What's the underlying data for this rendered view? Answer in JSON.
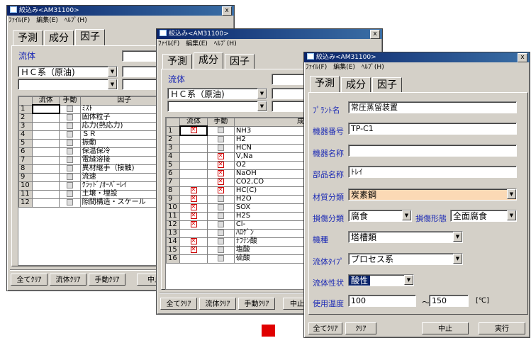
{
  "windows": {
    "title": "絞込み<AM31100>",
    "close_label": "x",
    "menu": [
      "ﾌｧｲﾙ(F)",
      "編集(E)",
      "ﾍﾙﾌﾟ(H)"
    ],
    "tabs": [
      "予測",
      "成分",
      "因子"
    ]
  },
  "win1": {
    "fluid_label": "流体",
    "fluid_value": "ＨＣ系（原油)",
    "grid_headers": [
      "流体",
      "手動",
      "因子"
    ],
    "rows": [
      "ﾐｽﾄ",
      "固体粒子",
      "応力(熱応力)",
      "ＳＲ",
      "振動",
      "保温保冷",
      "電縫溶接",
      "異材継手（接触)",
      "流速",
      "ｸﾗｯﾄﾞ/ｵｰﾊﾞｰﾚｲ",
      "土壌・埋設",
      "隙間構造・スケール"
    ],
    "row_numbers": [
      "1",
      "2",
      "3",
      "4",
      "5",
      "6",
      "7",
      "8",
      "9",
      "10",
      "11",
      "12"
    ],
    "buttons": [
      "全てｸﾘｱ",
      "流体ｸﾘｱ",
      "手動ｸﾘｱ",
      "中止"
    ]
  },
  "win2": {
    "fluid_label": "流体",
    "fluid_value": "ＨＣ系（原油)",
    "grid_headers": [
      "流体",
      "手動",
      "成分"
    ],
    "rows": [
      {
        "n": "1",
        "fluid": true,
        "manual": false,
        "name": "NH3"
      },
      {
        "n": "2",
        "fluid": false,
        "manual": false,
        "name": "H2"
      },
      {
        "n": "3",
        "fluid": false,
        "manual": false,
        "name": "HCN"
      },
      {
        "n": "4",
        "fluid": false,
        "manual": true,
        "name": "V,Na"
      },
      {
        "n": "5",
        "fluid": false,
        "manual": true,
        "name": "O2"
      },
      {
        "n": "6",
        "fluid": false,
        "manual": true,
        "name": "NaOH"
      },
      {
        "n": "7",
        "fluid": false,
        "manual": true,
        "name": "CO2,CO"
      },
      {
        "n": "8",
        "fluid": true,
        "manual": true,
        "name": "HC(C)"
      },
      {
        "n": "9",
        "fluid": true,
        "manual": false,
        "name": "H2O"
      },
      {
        "n": "10",
        "fluid": true,
        "manual": false,
        "name": "SOX"
      },
      {
        "n": "11",
        "fluid": true,
        "manual": false,
        "name": "H2S"
      },
      {
        "n": "12",
        "fluid": true,
        "manual": false,
        "name": "Cl-"
      },
      {
        "n": "13",
        "fluid": false,
        "manual": false,
        "name": "ﾊﾛｹﾞﾝ"
      },
      {
        "n": "14",
        "fluid": true,
        "manual": false,
        "name": "ﾅﾌﾃﾝ酸"
      },
      {
        "n": "15",
        "fluid": true,
        "manual": false,
        "name": "塩酸"
      },
      {
        "n": "16",
        "fluid": false,
        "manual": false,
        "name": "硫酸"
      }
    ],
    "buttons": [
      "全てｸﾘｱ",
      "流体ｸﾘｱ",
      "手動ｸﾘｱ",
      "中止"
    ]
  },
  "win3": {
    "fields": {
      "plant_label": "ﾌﾟﾗﾝﾄ名",
      "plant_value": "常圧蒸留装置",
      "equip_no_label": "機器番号",
      "equip_no_value": "TP-C1",
      "equip_name_label": "機器名称",
      "equip_name_value": "",
      "part_label": "部品名称",
      "part_value": "ﾄﾚｲ",
      "material_label": "材質分類",
      "material_value": "炭素鋼",
      "damage_class_label": "損傷分類",
      "damage_class_value": "腐食",
      "damage_form_label": "損傷形態",
      "damage_form_value": "全面腐食",
      "type_label": "機種",
      "type_value": "塔槽類",
      "fluid_type_label": "流体ﾀｲﾌﾟ",
      "fluid_type_value": "プロセス系",
      "fluid_prop_label": "流体性状",
      "fluid_prop_value": "酸性",
      "temp_label": "使用温度",
      "temp_from": "100",
      "temp_sep": "～",
      "temp_to": "150",
      "temp_unit": "[℃]"
    },
    "buttons": [
      "全てｸﾘｱ",
      "ｸﾘｱ",
      "中止",
      "実行"
    ]
  },
  "colors": {
    "title_bar": "#0a246a",
    "label_blue": "#1d2bb5",
    "material_bg": "#fbd9b5",
    "selection": "#0a246a",
    "marker_red": "#e00000"
  }
}
